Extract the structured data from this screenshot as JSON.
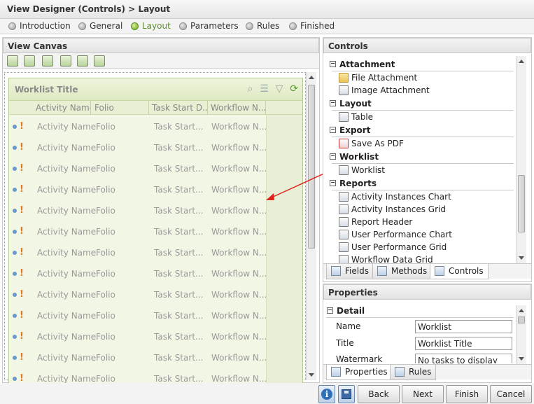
{
  "header": {
    "title": "View Designer (Controls) > Layout"
  },
  "steps": [
    {
      "label": "Introduction",
      "active": false
    },
    {
      "label": "General",
      "active": false
    },
    {
      "label": "Layout",
      "active": true
    },
    {
      "label": "Parameters",
      "active": false
    },
    {
      "label": "Rules",
      "active": false
    },
    {
      "label": "Finished",
      "active": false
    }
  ],
  "canvas": {
    "title": "View Canvas",
    "toolbar_icons": [
      "add-control-icon",
      "edit-icon",
      "upload-icon",
      "export-icon",
      "sum-icon",
      "wizard-icon"
    ],
    "worklist": {
      "title": "Worklist Title",
      "tools": [
        "search-icon",
        "list-icon",
        "filter-icon",
        "refresh-icon"
      ],
      "columns": [
        "Activity Name",
        "Folio",
        "Task Start D...",
        "Workflow N..."
      ],
      "row_values": [
        "Activity Name",
        "Folio",
        "Task Start...",
        "Workflow N..."
      ],
      "row_count": 13
    }
  },
  "controls": {
    "title": "Controls",
    "groups": [
      {
        "label": "Attachment",
        "items": [
          {
            "label": "File Attachment",
            "icon": "folder-icon"
          },
          {
            "label": "Image Attachment",
            "icon": "image-icon"
          }
        ]
      },
      {
        "label": "Layout",
        "items": [
          {
            "label": "Table",
            "icon": "table-icon"
          }
        ]
      },
      {
        "label": "Export",
        "items": [
          {
            "label": "Save As PDF",
            "icon": "pdf-icon"
          }
        ]
      },
      {
        "label": "Worklist",
        "items": [
          {
            "label": "Worklist",
            "icon": "worklist-icon"
          }
        ]
      },
      {
        "label": "Reports",
        "items": [
          {
            "label": "Activity Instances Chart",
            "icon": "chart-icon"
          },
          {
            "label": "Activity Instances Grid",
            "icon": "grid-icon"
          },
          {
            "label": "Report Header",
            "icon": "report-icon"
          },
          {
            "label": "User Performance Chart",
            "icon": "chart-icon"
          },
          {
            "label": "User Performance Grid",
            "icon": "grid-icon"
          },
          {
            "label": "Workflow Data Grid",
            "icon": "grid-icon"
          }
        ]
      }
    ],
    "tabs": [
      {
        "label": "Fields"
      },
      {
        "label": "Methods"
      },
      {
        "label": "Controls"
      }
    ]
  },
  "properties": {
    "title": "Properties",
    "section": "Detail",
    "fields": [
      {
        "label": "Name",
        "value": "Worklist"
      },
      {
        "label": "Title",
        "value": "Worklist Title"
      },
      {
        "label": "Watermark",
        "value": "No tasks to display"
      }
    ],
    "tabs": [
      {
        "label": "Properties"
      },
      {
        "label": "Rules"
      }
    ]
  },
  "footer": {
    "back": "Back",
    "next": "Next",
    "finish": "Finish",
    "cancel": "Cancel"
  },
  "colors": {
    "accent": "#6aa81e",
    "worklist_bg": "#f2f6e4",
    "arrow": "#e0241b"
  }
}
